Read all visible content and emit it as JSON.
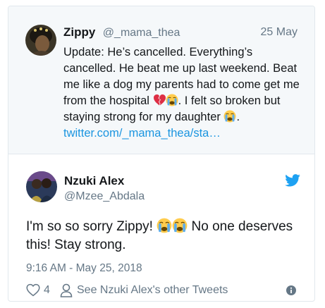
{
  "quoted_tweet": {
    "author_name": "Zippy",
    "author_handle": "@_mama_thea",
    "date": "25 May",
    "text_part1": "Update: He’s cancelled. Everything’s cancelled. He beat me up last weekend. Beat me like a dog my parents had to come get me from the hospital ",
    "text_part2": ". I felt so broken but staying strong for my daughter ",
    "text_part3": ".",
    "link": "twitter.com/_mama_thea/sta…",
    "emojis": [
      "broken-heart",
      "loudly-crying-face",
      "loudly-crying-face"
    ]
  },
  "tweet": {
    "author_name": "Nzuki Alex",
    "author_handle": "@Mzee_Abdala",
    "text_part1": "I'm so so sorry Zippy! ",
    "text_part2": "  No one deserves this! Stay strong.",
    "emojis": [
      "loudly-crying-face",
      "loudly-crying-face"
    ],
    "timestamp": "9:16 AM - May 25, 2018",
    "like_count": "4",
    "see_other_label": "See Nzuki Alex's other Tweets"
  },
  "colors": {
    "link": "#1b95e0",
    "muted": "#657786",
    "twitter_blue": "#1da1f2",
    "quoted_bg": "#f5f8fa"
  }
}
